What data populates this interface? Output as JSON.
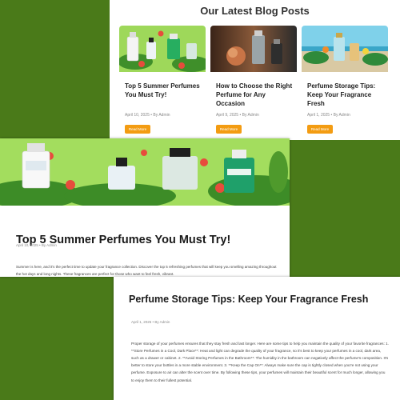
{
  "listing": {
    "heading": "Our Latest Blog Posts",
    "cards": [
      {
        "title": "Top 5 Summer Perfumes You Must Try!",
        "meta": "April 10, 2025 • By Admin",
        "button": "Read More"
      },
      {
        "title": "How to Choose the Right Perfume for Any Occasion",
        "meta": "April 9, 2025 • By Admin",
        "button": "Read More"
      },
      {
        "title": "Perfume Storage Tips: Keep Your Fragrance Fresh",
        "meta": "April 1, 2025 • By Admin",
        "button": "Read More"
      }
    ]
  },
  "article1": {
    "title": "Top 5 Summer Perfumes You Must Try!",
    "meta": "April 10, 2025 • By Admin",
    "body": "Summer is here, and it's the perfect time to update your fragrance collection. Discover the top 5 refreshing perfumes that will keep you smelling amazing throughout the hot days and long nights. These fragrances are perfect for those who want to feel fresh, vibrant."
  },
  "article2": {
    "title": "Perfume Storage Tips: Keep Your Fragrance Fresh",
    "meta": "April 1, 2025 • By Admin",
    "body": "Proper storage of your perfumes ensures that they stay fresh and last longer. Here are some tips to help you maintain the quality of your favorite fragrances: 1. **Store Perfumes in a Cool, Dark Place**: Heat and light can degrade the quality of your fragrance, so it's best to keep your perfumes in a cool, dark area, such as a drawer or cabinet. 2. **Avoid Storing Perfumes in the Bathroom**: The humidity in the bathroom can negatively affect the perfume's composition. It's better to store your bottles in a more stable environment. 3. **Keep the Cap On**: Always make sure the cap is tightly closed when you're not using your perfume. Exposure to air can alter the scent over time. By following these tips, your perfumes will maintain their beautiful scent for much longer, allowing you to enjoy them to their fullest potential."
  },
  "colors": {
    "background": "#4a7a19",
    "accent": "#f39c12"
  }
}
